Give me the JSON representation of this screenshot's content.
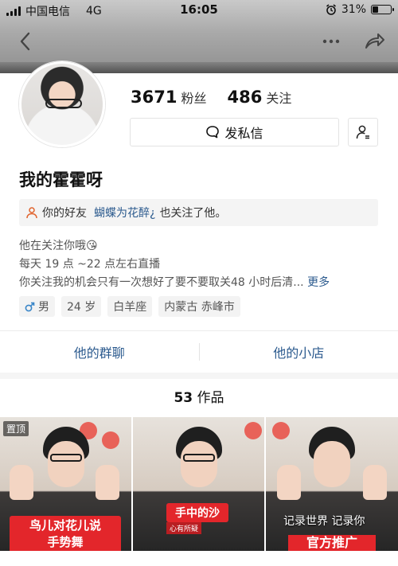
{
  "status_bar": {
    "carrier": "中国电信",
    "network": "4G",
    "time": "16:05",
    "battery_percent": "31%",
    "battery_level": 0.31
  },
  "nav": {
    "back_icon": "chevron-left-icon",
    "more_icon": "more-dots-icon",
    "share_icon": "share-arrow-icon"
  },
  "profile": {
    "fans_count": "3671",
    "fans_label": "粉丝",
    "following_count": "486",
    "following_label": "关注",
    "message_button": "发私信",
    "nickname": "我的霍霍呀",
    "friend_notice": {
      "prefix": "你的好友",
      "friend_name": "蝴蝶为花醉¿",
      "suffix": "也关注了他。"
    },
    "bio_lines": [
      "他在关注你哦😘",
      "每天 19 点 ~22 点左右直播",
      "你关注我的机会只有一次想好了要不要取关48 小时后清..."
    ],
    "bio_more": "更多",
    "tags": {
      "gender": "男",
      "age": "24 岁",
      "zodiac": "白羊座",
      "location": "内蒙古 赤峰市"
    }
  },
  "links": {
    "group_chat": "他的群聊",
    "shop": "他的小店"
  },
  "works": {
    "count": "53",
    "label": "作品",
    "items": [
      {
        "pinned_label": "置顶",
        "caption_line1": "鸟儿对花儿说",
        "caption_line2": "手势舞"
      },
      {
        "caption": "手中的沙",
        "sub_caption": "心有所疑"
      },
      {
        "caption": "记录世界 记录你",
        "banner": "官方推广"
      }
    ]
  },
  "colors": {
    "link_blue": "#2b5a8e",
    "caption_red": "#e3262b"
  }
}
